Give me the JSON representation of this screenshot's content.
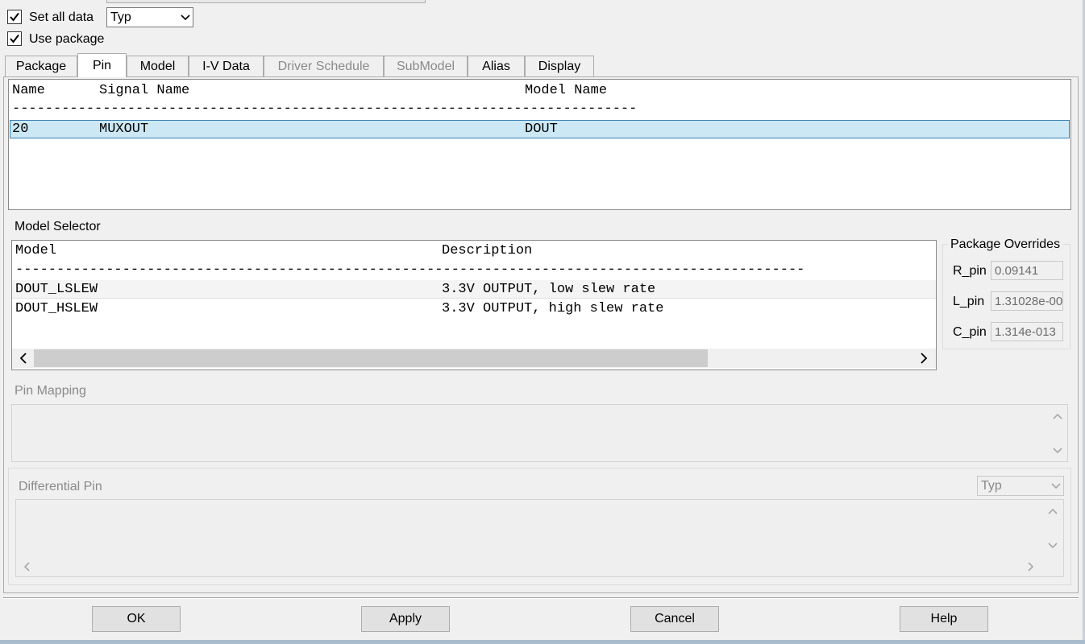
{
  "options": {
    "set_all_data_label": "Set all data",
    "set_all_data_checked": true,
    "corner_select_value": "Typ",
    "use_package_label": "Use package",
    "use_package_checked": true
  },
  "tabs": [
    {
      "label": "Package",
      "state": "normal"
    },
    {
      "label": "Pin",
      "state": "active"
    },
    {
      "label": "Model",
      "state": "normal"
    },
    {
      "label": "I-V Data",
      "state": "normal"
    },
    {
      "label": "Driver Schedule",
      "state": "disabled"
    },
    {
      "label": "SubModel",
      "state": "disabled"
    },
    {
      "label": "Alias",
      "state": "normal"
    },
    {
      "label": "Display",
      "state": "normal"
    }
  ],
  "pin_list": {
    "headers": {
      "name": "Name",
      "signal": "Signal Name",
      "model": "Model Name"
    },
    "dashes": "----------------------------------------------------------------------------",
    "rows": [
      {
        "name": "20",
        "signal": "MUXOUT",
        "model": "DOUT"
      }
    ]
  },
  "model_selector": {
    "label": "Model Selector",
    "headers": {
      "model": "Model",
      "description": "Description"
    },
    "dashes": "------------------------------------------------------------------------------------------------",
    "rows": [
      {
        "model": "DOUT_LSLEW",
        "description": "3.3V OUTPUT, low slew rate"
      },
      {
        "model": "DOUT_HSLEW",
        "description": "3.3V OUTPUT, high slew rate"
      }
    ]
  },
  "package_overrides": {
    "title": "Package Overrides",
    "r_pin_label": "R_pin",
    "r_pin_value": "0.09141",
    "l_pin_label": "L_pin",
    "l_pin_value": "1.31028e-00",
    "c_pin_label": "C_pin",
    "c_pin_value": "1.314e-013"
  },
  "pin_mapping": {
    "label": "Pin Mapping"
  },
  "differential_pin": {
    "label": "Differential Pin",
    "select_value": "Typ"
  },
  "buttons": {
    "ok": "OK",
    "apply": "Apply",
    "cancel": "Cancel",
    "help": "Help"
  },
  "colors": {
    "selection_bg": "#cce8f4",
    "selection_border": "#3c7fb1",
    "disabled_text": "#8a8a8a"
  }
}
